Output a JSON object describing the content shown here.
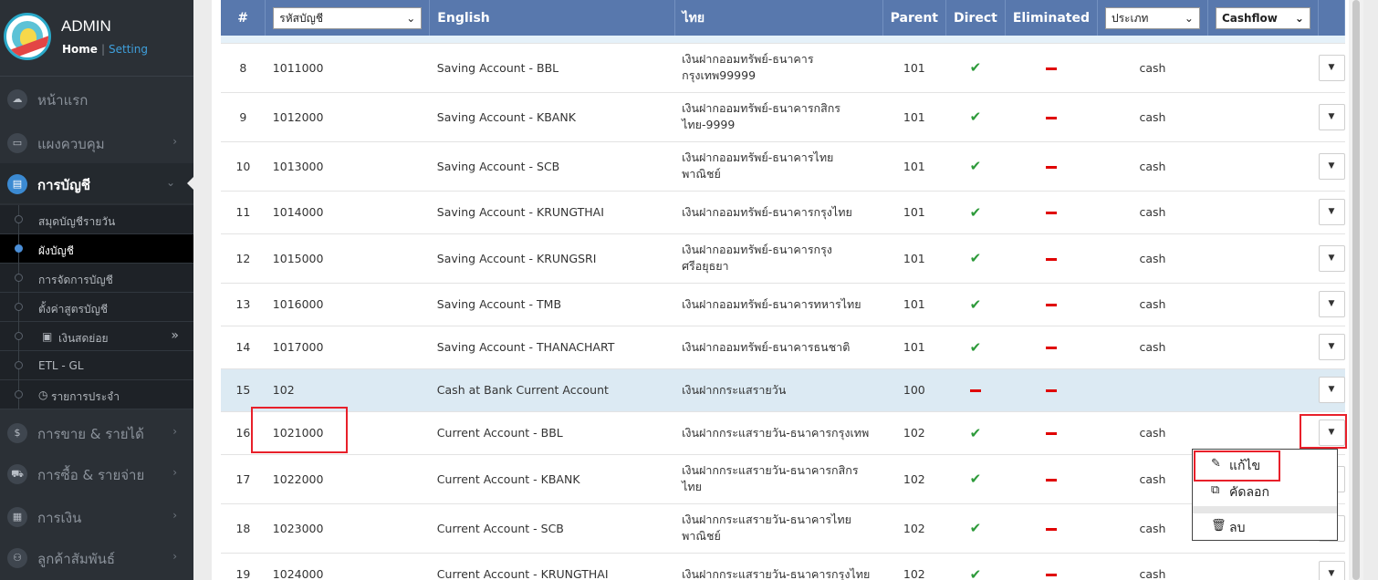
{
  "brand": {
    "title": "ADMIN",
    "home_link": "Home",
    "separator": "|",
    "setting_link": "Setting"
  },
  "nav": [
    {
      "label": "หน้าแรก",
      "icon": "cloud-icon"
    },
    {
      "label": "แผงควบคุม",
      "icon": "monitor-icon"
    },
    {
      "label": "การบัญชี",
      "icon": "book-icon"
    },
    {
      "label": "การขาย & รายได้",
      "icon": "dollar-icon"
    },
    {
      "label": "การซื้อ & รายจ่าย",
      "icon": "cart-icon"
    },
    {
      "label": "การเงิน",
      "icon": "calendar-icon"
    },
    {
      "label": "ลูกค้าสัมพันธ์",
      "icon": "users-icon"
    }
  ],
  "subnav": [
    {
      "label": "สมุดบัญชีรายวัน"
    },
    {
      "label": "ผังบัญชี"
    },
    {
      "label": "การจัดการบัญชี"
    },
    {
      "label": "ตั้งค่าสูตรบัญชี"
    },
    {
      "label": "เงินสดย่อย",
      "prefix_icon": "id-card-icon"
    },
    {
      "label": "ETL - GL"
    },
    {
      "label": "รายการประจำ",
      "prefix_icon": "clock-icon"
    }
  ],
  "table": {
    "headers": {
      "num": "#",
      "code_filter": "รหัสบัญชี",
      "english": "English",
      "thai": "ไทย",
      "parent": "Parent",
      "direct": "Direct",
      "eliminated": "Eliminated",
      "type_filter": "ประเภท",
      "cashflow_filter": "Cashflow"
    },
    "rows": [
      {
        "num": "8",
        "code": "1011000",
        "english": "Saving Account - BBL",
        "thai1": "เงินฝากออมทรัพย์-ธนาคาร",
        "thai2": "กรุงเทพ99999",
        "parent": "101",
        "direct": true,
        "eliminated": false,
        "cashflow": "cash"
      },
      {
        "num": "9",
        "code": "1012000",
        "english": "Saving Account - KBANK",
        "thai1": "เงินฝากออมทรัพย์-ธนาคารกสิกร",
        "thai2": "ไทย-9999",
        "parent": "101",
        "direct": true,
        "eliminated": false,
        "cashflow": "cash"
      },
      {
        "num": "10",
        "code": "1013000",
        "english": "Saving Account - SCB",
        "thai1": "เงินฝากออมทรัพย์-ธนาคารไทย",
        "thai2": "พาณิชย์",
        "parent": "101",
        "direct": true,
        "eliminated": false,
        "cashflow": "cash"
      },
      {
        "num": "11",
        "code": "1014000",
        "english": "Saving Account - KRUNGTHAI",
        "thai1": "เงินฝากออมทรัพย์-ธนาคารกรุงไทย",
        "thai2": "",
        "parent": "101",
        "direct": true,
        "eliminated": false,
        "cashflow": "cash"
      },
      {
        "num": "12",
        "code": "1015000",
        "english": "Saving Account - KRUNGSRI",
        "thai1": "เงินฝากออมทรัพย์-ธนาคารกรุง",
        "thai2": "ศรีอยุธยา",
        "parent": "101",
        "direct": true,
        "eliminated": false,
        "cashflow": "cash"
      },
      {
        "num": "13",
        "code": "1016000",
        "english": "Saving Account - TMB",
        "thai1": "เงินฝากออมทรัพย์-ธนาคารทหารไทย",
        "thai2": "",
        "parent": "101",
        "direct": true,
        "eliminated": false,
        "cashflow": "cash"
      },
      {
        "num": "14",
        "code": "1017000",
        "english": "Saving Account - THANACHART",
        "thai1": "เงินฝากออมทรัพย์-ธนาคารธนชาติ",
        "thai2": "",
        "parent": "101",
        "direct": true,
        "eliminated": false,
        "cashflow": "cash"
      },
      {
        "num": "15",
        "code": "102",
        "english": "Cash at Bank Current Account",
        "thai1": "เงินฝากกระแสรายวัน",
        "thai2": "",
        "parent": "100",
        "direct": false,
        "eliminated": false,
        "cashflow": ""
      },
      {
        "num": "16",
        "code": "1021000",
        "english": "Current Account - BBL",
        "thai1": "เงินฝากกระแสรายวัน-ธนาคารกรุงเทพ",
        "thai2": "",
        "parent": "102",
        "direct": true,
        "eliminated": false,
        "cashflow": "cash"
      },
      {
        "num": "17",
        "code": "1022000",
        "english": "Current Account - KBANK",
        "thai1": "เงินฝากกระแสรายวัน-ธนาคารกสิกร",
        "thai2": "ไทย",
        "parent": "102",
        "direct": true,
        "eliminated": false,
        "cashflow": "cash"
      },
      {
        "num": "18",
        "code": "1023000",
        "english": "Current Account - SCB",
        "thai1": "เงินฝากกระแสรายวัน-ธนาคารไทย",
        "thai2": "พาณิชย์",
        "parent": "102",
        "direct": true,
        "eliminated": false,
        "cashflow": "cash"
      },
      {
        "num": "19",
        "code": "1024000",
        "english": "Current Account - KRUNGTHAI",
        "thai1": "เงินฝากกระแสรายวัน-ธนาคารกรุงไทย",
        "thai2": "",
        "parent": "102",
        "direct": true,
        "eliminated": false,
        "cashflow": "cash"
      }
    ]
  },
  "dropdown_menu": {
    "edit": "แก้ไข",
    "copy": "คัดลอก",
    "delete": "ลบ"
  },
  "colors": {
    "header_bg": "#5878ad",
    "sidebar_bg": "#2b3036",
    "check": "#2d9a3a",
    "dash": "#e00000",
    "highlight_row": "#dceaf3",
    "annotation_box": "#e8202a"
  }
}
